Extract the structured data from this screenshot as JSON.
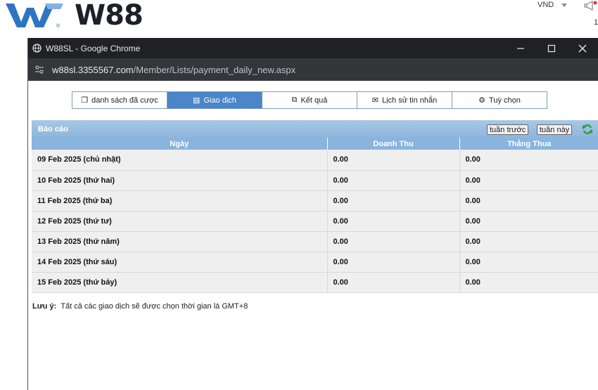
{
  "site": {
    "logo_text": "W88",
    "currency": "VND",
    "counter": "1"
  },
  "window": {
    "title": "W88SL - Google Chrome",
    "url_host": "w88sl.3355567.com",
    "url_path": "/Member/Lists/payment_daily_new.aspx"
  },
  "tabs": [
    {
      "label": "danh sách đã cược",
      "icon": "clipboard-icon"
    },
    {
      "label": "Giao dịch",
      "icon": "list-icon",
      "active": true
    },
    {
      "label": "Kết quả",
      "icon": "window-icon"
    },
    {
      "label": "Lịch sử tin nhắn",
      "icon": "envelope-icon"
    },
    {
      "label": "Tuỳ chọn",
      "icon": "gear-icon"
    }
  ],
  "report": {
    "title": "Báo cáo",
    "prev_week": "tuần trước",
    "this_week": "tuần này",
    "columns": [
      "Ngày",
      "Doanh Thu",
      "Thắng Thua"
    ],
    "rows": [
      {
        "date": "09 Feb 2025 (chủ nhật)",
        "revenue": "0.00",
        "winloss": "0.00"
      },
      {
        "date": "10 Feb 2025 (thứ hai)",
        "revenue": "0.00",
        "winloss": "0.00"
      },
      {
        "date": "11 Feb 2025 (thứ ba)",
        "revenue": "0.00",
        "winloss": "0.00"
      },
      {
        "date": "12 Feb 2025 (thứ tư)",
        "revenue": "0.00",
        "winloss": "0.00"
      },
      {
        "date": "13 Feb 2025 (thứ năm)",
        "revenue": "0.00",
        "winloss": "0.00"
      },
      {
        "date": "14 Feb 2025 (thứ sáu)",
        "revenue": "0.00",
        "winloss": "0.00"
      },
      {
        "date": "15 Feb 2025 (thứ bảy)",
        "revenue": "0.00",
        "winloss": "0.00"
      }
    ]
  },
  "note": {
    "label": "Lưu ý:",
    "text": "Tất cả các giao dịch sẽ được chọn thời gian là GMT+8"
  },
  "colors": {
    "active_tab": "#4a86c8",
    "header_blue": "#89b4dd",
    "titlebar": "#202124"
  }
}
